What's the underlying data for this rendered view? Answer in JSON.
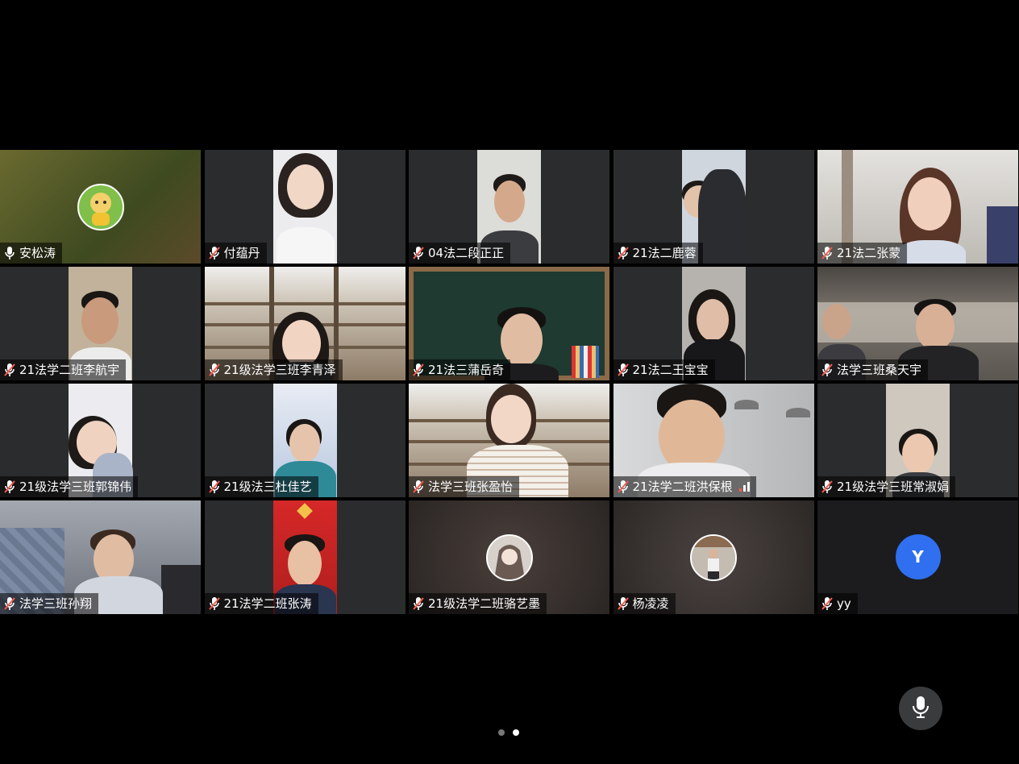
{
  "participants": [
    {
      "name": "安松涛",
      "mic": "on",
      "video": false,
      "avatar": "cartoon-avatar",
      "bg": "#5a5a2a"
    },
    {
      "name": "付蕴丹",
      "mic": "muted",
      "video": true,
      "bg": "#e9e9ec"
    },
    {
      "name": "04法二段正正",
      "mic": "muted",
      "video": true,
      "bg": "#d8d8d4"
    },
    {
      "name": "21法二鹿蓉",
      "mic": "muted",
      "video": true,
      "bg": "#cfd6dd"
    },
    {
      "name": "21法二张蒙",
      "mic": "muted",
      "video": true,
      "bg": "#c9cbcc"
    },
    {
      "name": "21法学二班李航宇",
      "mic": "muted",
      "video": true,
      "bg": "#b9a892"
    },
    {
      "name": "21级法学三班李青泽",
      "mic": "muted",
      "video": true,
      "bg": "#8a7a68"
    },
    {
      "name": "21法三蒲岳奇",
      "mic": "muted",
      "video": true,
      "bg": "#1f3a30"
    },
    {
      "name": "21法二王宝宝",
      "mic": "muted",
      "video": true,
      "bg": "#a8a6a2"
    },
    {
      "name": "法学三班桑天宇",
      "mic": "muted",
      "video": true,
      "bg": "#6e6a64"
    },
    {
      "name": "21级法学三班郭锦伟",
      "mic": "muted",
      "video": true,
      "bg": "#e6e6ea"
    },
    {
      "name": "21级法三杜佳艺",
      "mic": "muted",
      "video": true,
      "bg": "#c8d6ea"
    },
    {
      "name": "法学三班张盈怡",
      "mic": "muted",
      "video": true,
      "bg": "#8a7a68"
    },
    {
      "name": "21法学二班洪保根",
      "mic": "muted",
      "video": true,
      "bg": "#c5c7c9",
      "signal": true
    },
    {
      "name": "21级法学三班常淑娟",
      "mic": "muted",
      "video": true,
      "bg": "#bdb6ac"
    },
    {
      "name": "法学三班孙翔",
      "mic": "muted",
      "video": true,
      "bg": "#8c8f96"
    },
    {
      "name": "21法学二班张涛",
      "mic": "muted",
      "video": true,
      "bg": "#c92a2a"
    },
    {
      "name": "21级法学二班骆艺墨",
      "mic": "muted",
      "video": false,
      "avatar": "anime-avatar",
      "bg": "#3a3230"
    },
    {
      "name": "杨凌凌",
      "mic": "muted",
      "video": false,
      "avatar": "photo-avatar",
      "bg": "#3a3533"
    },
    {
      "name": "yy",
      "mic": "muted",
      "video": false,
      "avatar_letter": "Y",
      "bg": "#1c1c1e"
    }
  ],
  "pagination": {
    "pages": 2,
    "current": 2
  },
  "controls": {
    "mic_button": "microphone-icon"
  },
  "colors": {
    "muted_icon": "#ff5a4f",
    "letter_avatar": "#2f6ff0",
    "background": "#000000"
  }
}
